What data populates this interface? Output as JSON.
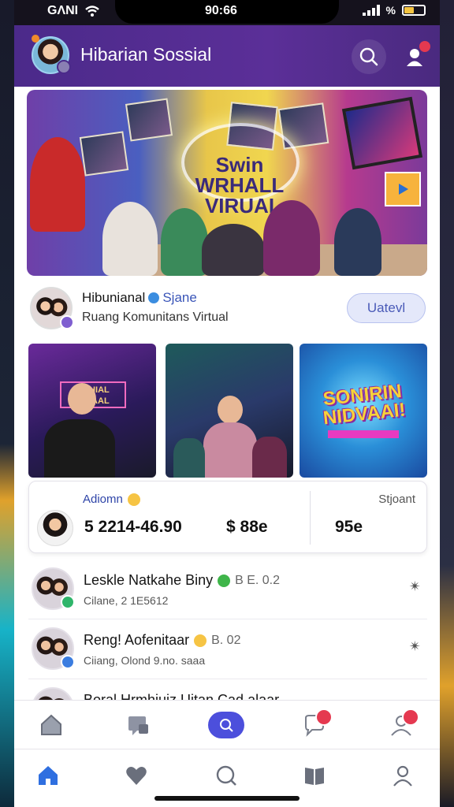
{
  "status_bar": {
    "carrier": "GΛNI",
    "time": "90:66",
    "signal_text": "%"
  },
  "header": {
    "title": "Hibarian Sossial"
  },
  "banner": {
    "sign_text": "Swin WRHALL VIRUAI"
  },
  "community": {
    "name": "Hibunianal",
    "tag": "Sjane",
    "subtitle": "Ruang Komunitans Virtual",
    "join_label": "Uatevl"
  },
  "gallery": {
    "tile1_sign": "URHIAL MIVAAL",
    "tile3_title": "SONIRIN NIDVAAI!"
  },
  "stats": {
    "left_label": "Adiomn",
    "right_label": "Stjoant",
    "value1": "5 2214-46.90",
    "value2": "$ 88e",
    "value3": "95e"
  },
  "list": [
    {
      "title": "Leskle Natkahe Biny",
      "meta": "B E. 0.2",
      "subtitle": "Cilane, 2 1E5612",
      "more": "✴"
    },
    {
      "title": "Reng! Aofenitaar",
      "meta": "B. 02",
      "subtitle": "Ciiang, Olond 9.no. saaa",
      "more": "✴"
    },
    {
      "title": "Boral Hrmhiuiz Uitan Cad alaar",
      "meta": "",
      "subtitle": "",
      "more": ""
    }
  ],
  "colors": {
    "header_bg": "#4b2a8a",
    "accent": "#4c4fdc",
    "badge": "#e53950",
    "join_bg": "#e4e8fa",
    "active_tab": "#2f6fe0"
  },
  "icons": {
    "tabbar_top": [
      "home-icon",
      "message-card-icon",
      "search-icon",
      "chat-bubble-icon",
      "people-icon"
    ],
    "tabbar_bottom": [
      "home-icon",
      "heart-icon",
      "search-chat-icon",
      "book-icon",
      "user-icon"
    ]
  }
}
